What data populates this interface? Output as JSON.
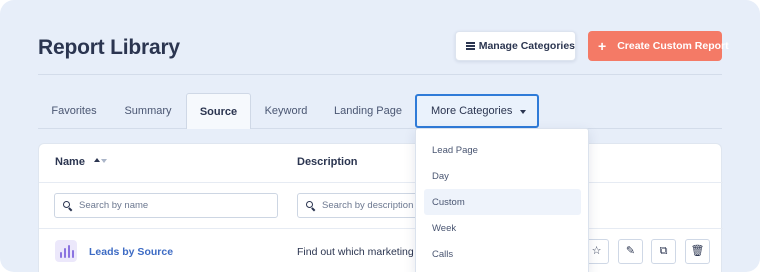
{
  "header": {
    "title": "Report Library",
    "manage_button": "Manage Categories",
    "create_button": "Create Custom Report",
    "create_icon": "+"
  },
  "tabs": [
    {
      "label": "Favorites"
    },
    {
      "label": "Summary"
    },
    {
      "label": "Source",
      "active": true
    },
    {
      "label": "Keyword"
    },
    {
      "label": "Landing Page"
    },
    {
      "label": "More Categories",
      "dropdown_open": true
    }
  ],
  "table": {
    "columns": [
      "Name",
      "Description"
    ],
    "name_search_placeholder": "Search by name",
    "description_search_placeholder": "Search by description",
    "rows": [
      {
        "name": "Leads by Source",
        "description": "Find out which marketing c",
        "icon": "bar-chart-icon"
      }
    ],
    "row_actions": [
      "star-icon",
      "pencil-icon",
      "copy-icon",
      "trash-icon"
    ]
  },
  "dropdown": {
    "items": [
      "Lead Page",
      "Day",
      "Custom",
      "Week",
      "Calls"
    ],
    "highlighted": "Custom"
  },
  "colors": {
    "background": "#e7eef9",
    "accent": "#f47a66",
    "link": "#3d6bc4",
    "focus": "#2f7bd8"
  }
}
